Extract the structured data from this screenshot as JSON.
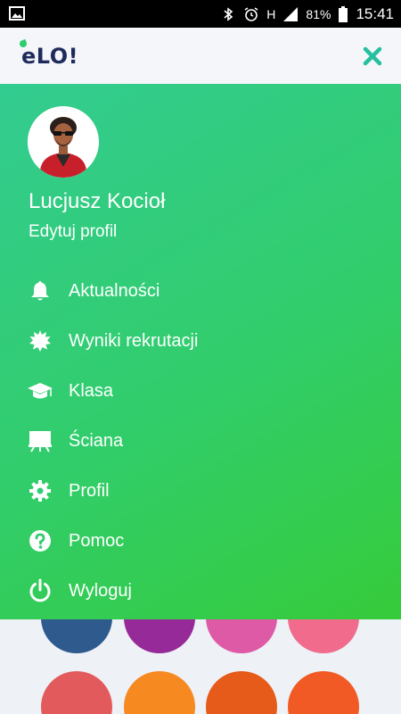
{
  "status_bar": {
    "battery": "81%",
    "time": "15:41",
    "network": "H"
  },
  "header": {
    "logo": "eLO!",
    "close_icon": "close-icon"
  },
  "drawer": {
    "user_name": "Lucjusz Kocioł",
    "edit_profile": "Edytuj profil",
    "items": [
      {
        "label": "Aktualności",
        "icon": "bell-icon"
      },
      {
        "label": "Wyniki rekrutacji",
        "icon": "badge-icon"
      },
      {
        "label": "Klasa",
        "icon": "graduation-cap-icon"
      },
      {
        "label": "Ściana",
        "icon": "board-icon"
      },
      {
        "label": "Profil",
        "icon": "gear-icon"
      },
      {
        "label": "Pomoc",
        "icon": "help-icon"
      },
      {
        "label": "Wyloguj",
        "icon": "power-icon"
      }
    ]
  },
  "colors": {
    "gradient_start": "#33cc91",
    "gradient_end": "#36cb3a",
    "logo_text": "#1f2b5c",
    "close_icon": "#26bfa0",
    "circles": [
      "#2f5a8e",
      "#962a98",
      "#de5aa6",
      "#f06b8c",
      "#e35a5c",
      "#f6891f",
      "#e65a1a",
      "#f15a24"
    ]
  }
}
